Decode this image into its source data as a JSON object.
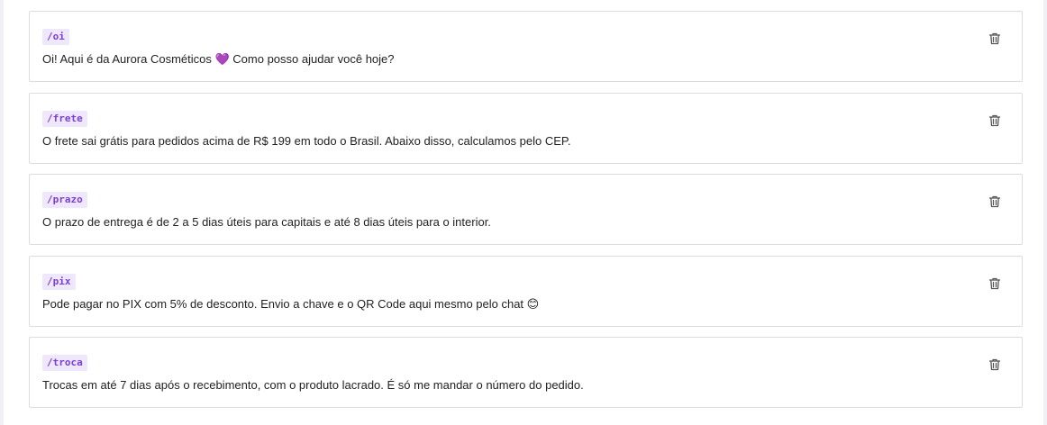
{
  "quick_replies": [
    {
      "shortcut": "/oi",
      "message": "Oi! Aqui é da Aurora Cosméticos 💜 Como posso ajudar você hoje?"
    },
    {
      "shortcut": "/frete",
      "message": "O frete sai grátis para pedidos acima de R$ 199 em todo o Brasil. Abaixo disso, calculamos pelo CEP."
    },
    {
      "shortcut": "/prazo",
      "message": "O prazo de entrega é de 2 a 5 dias úteis para capitais e até 8 dias úteis para o interior."
    },
    {
      "shortcut": "/pix",
      "message": "Pode pagar no PIX com 5% de desconto. Envio a chave e o QR Code aqui mesmo pelo chat 😊"
    },
    {
      "shortcut": "/troca",
      "message": "Trocas em até 7 dias após o recebimento, com o produto lacrado. É só me mandar o número do pedido."
    }
  ],
  "icons": {
    "delete": "trash-icon"
  },
  "colors": {
    "shortcut_text": "#7a3fd6",
    "shortcut_bg": "#efe7fc",
    "border": "#dcdce2"
  }
}
